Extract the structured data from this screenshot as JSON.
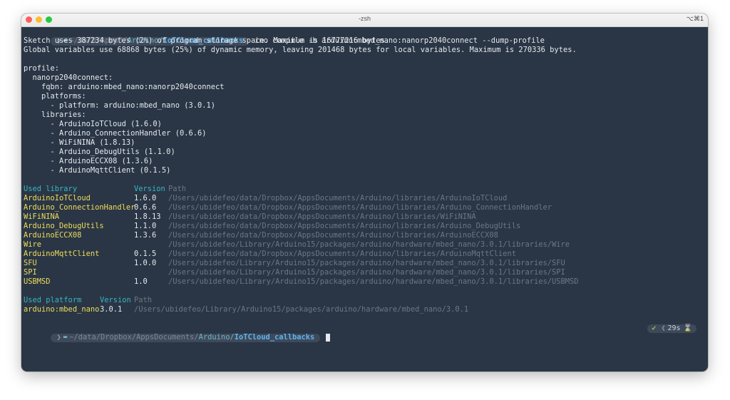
{
  "window": {
    "title": "-zsh",
    "shortcut": "⌥⌘1",
    "colors": {
      "close": "#fe5f57",
      "minimize": "#febc2e",
      "maximize": "#28c840",
      "background": "#2a3645"
    }
  },
  "prompt1": {
    "path_prefix": "~/da/D/AppsD/",
    "path_mid": "Arduino/",
    "path_current": "IoTCloud_callbacks",
    "command": "ino compile -b arduino:mbed_nano:nanorp2040connect --dump-profile"
  },
  "output": {
    "lines": [
      "Sketch uses 387234 bytes (2%) of program storage space. Maximum is 16777216 bytes.",
      "Global variables use 68868 bytes (25%) of dynamic memory, leaving 201468 bytes for local variables. Maximum is 270336 bytes.",
      "",
      "profile:",
      "  nanorp2040connect:",
      "    fqbn: arduino:mbed_nano:nanorp2040connect",
      "    platforms:",
      "      - platform: arduino:mbed_nano (3.0.1)",
      "    libraries:",
      "      - ArduinoIoTCloud (1.6.0)",
      "      - Arduino_ConnectionHandler (0.6.6)",
      "      - WiFiNINA (1.8.13)",
      "      - Arduino_DebugUtils (1.1.0)",
      "      - ArduinoECCX08 (1.3.6)",
      "      - ArduinoMqttClient (0.1.5)",
      ""
    ]
  },
  "libraries_table": {
    "headers": [
      "Used library",
      "Version",
      "Path"
    ],
    "rows": [
      {
        "name": "ArduinoIoTCloud",
        "version": "1.6.0",
        "path": "/Users/ubidefeo/data/Dropbox/AppsDocuments/Arduino/libraries/ArduinoIoTCloud"
      },
      {
        "name": "Arduino_ConnectionHandler",
        "version": "0.6.6",
        "path": "/Users/ubidefeo/data/Dropbox/AppsDocuments/Arduino/libraries/Arduino_ConnectionHandler"
      },
      {
        "name": "WiFiNINA",
        "version": "1.8.13",
        "path": "/Users/ubidefeo/data/Dropbox/AppsDocuments/Arduino/libraries/WiFiNINA"
      },
      {
        "name": "Arduino_DebugUtils",
        "version": "1.1.0",
        "path": "/Users/ubidefeo/data/Dropbox/AppsDocuments/Arduino/libraries/Arduino_DebugUtils"
      },
      {
        "name": "ArduinoECCX08",
        "version": "1.3.6",
        "path": "/Users/ubidefeo/data/Dropbox/AppsDocuments/Arduino/libraries/ArduinoECCX08"
      },
      {
        "name": "Wire",
        "version": "",
        "path": "/Users/ubidefeo/Library/Arduino15/packages/arduino/hardware/mbed_nano/3.0.1/libraries/Wire"
      },
      {
        "name": "ArduinoMqttClient",
        "version": "0.1.5",
        "path": "/Users/ubidefeo/data/Dropbox/AppsDocuments/Arduino/libraries/ArduinoMqttClient"
      },
      {
        "name": "SFU",
        "version": "1.0.0",
        "path": "/Users/ubidefeo/Library/Arduino15/packages/arduino/hardware/mbed_nano/3.0.1/libraries/SFU"
      },
      {
        "name": "SPI",
        "version": "",
        "path": "/Users/ubidefeo/Library/Arduino15/packages/arduino/hardware/mbed_nano/3.0.1/libraries/SPI"
      },
      {
        "name": "USBMSD",
        "version": "1.0",
        "path": "/Users/ubidefeo/Library/Arduino15/packages/arduino/hardware/mbed_nano/3.0.1/libraries/USBMSD"
      }
    ]
  },
  "platform_table": {
    "headers": [
      "Used platform",
      "Version",
      "Path"
    ],
    "rows": [
      {
        "name": "arduino:mbed_nano",
        "version": "3.0.1",
        "path": "/Users/ubidefeo/Library/Arduino15/packages/arduino/hardware/mbed_nano/3.0.1"
      }
    ]
  },
  "prompt2": {
    "path_prefix": "~/data/Dropbox/AppsDocuments/",
    "path_mid": "Arduino/",
    "path_current": "IoTCloud_callbacks",
    "status": "29s"
  },
  "icons": [
    "apple-icon",
    "chevron-right-icon",
    "folder-icon",
    "check-icon",
    "chevron-left-icon",
    "hourglass-icon"
  ]
}
